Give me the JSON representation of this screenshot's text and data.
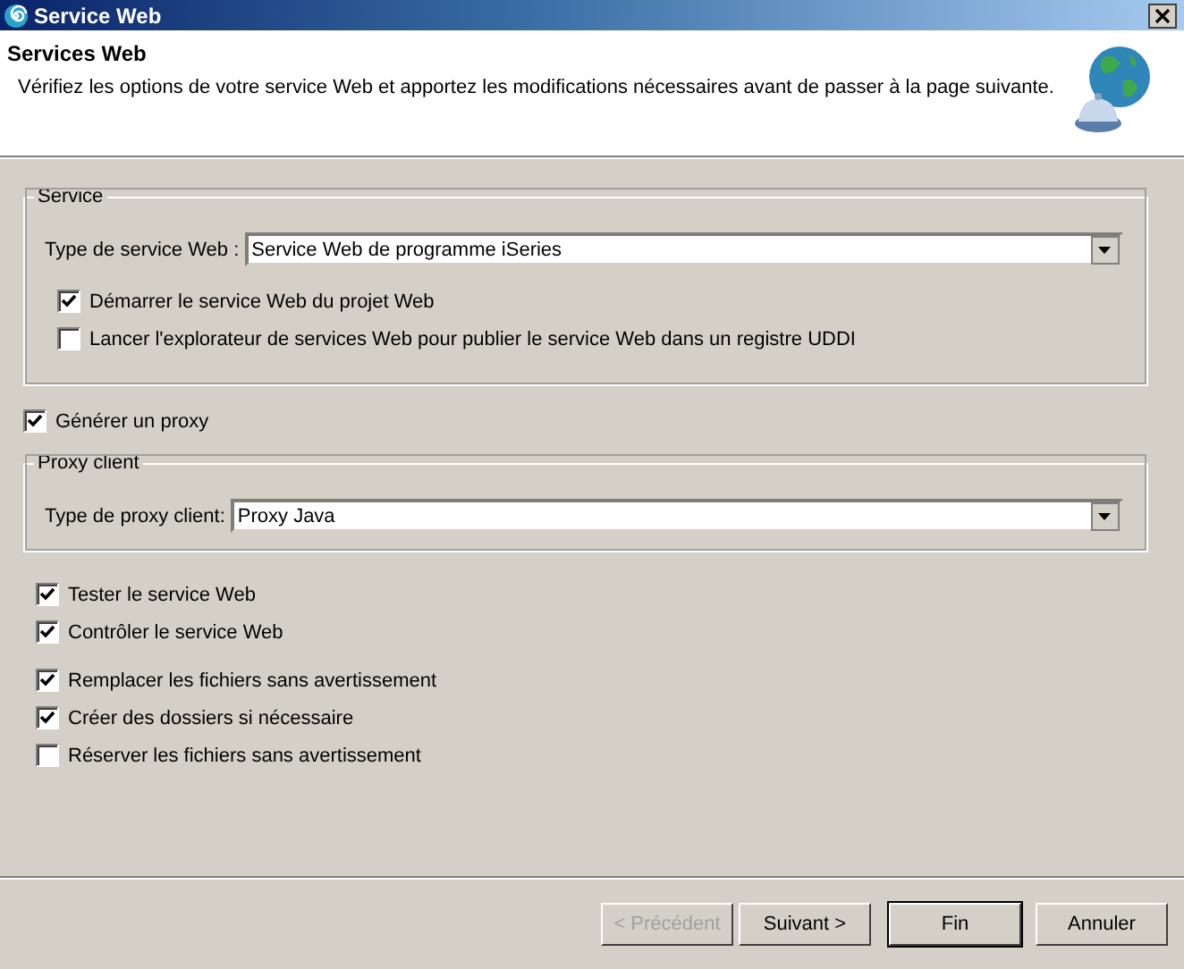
{
  "window": {
    "title": "Service Web"
  },
  "header": {
    "title": "Services Web",
    "description": "Vérifiez les options de votre service Web et apportez les modifications nécessaires avant de passer à la page suivante."
  },
  "service_group": {
    "legend": "Service",
    "type_label": "Type de service Web :",
    "type_value": "Service Web de programme iSeries",
    "options": [
      {
        "label": "Démarrer le service Web du projet Web",
        "checked": true
      },
      {
        "label": "Lancer l'explorateur de services Web pour publier le service Web dans un registre UDDI",
        "checked": false
      }
    ]
  },
  "generate_proxy": {
    "label": "Générer un proxy",
    "checked": true
  },
  "proxy_group": {
    "legend": "Proxy client",
    "type_label": "Type de proxy client:",
    "type_value": "Proxy Java"
  },
  "option_sets": [
    [
      {
        "label": "Tester le service Web",
        "checked": true
      },
      {
        "label": "Contrôler le service Web",
        "checked": true
      }
    ],
    [
      {
        "label": "Remplacer les fichiers sans avertissement",
        "checked": true
      },
      {
        "label": "Créer des dossiers si nécessaire",
        "checked": true
      },
      {
        "label": "Réserver les fichiers sans avertissement",
        "checked": false
      }
    ]
  ],
  "buttons": [
    {
      "label": "< Précédent",
      "disabled": true,
      "default": false
    },
    {
      "label": "Suivant >",
      "disabled": false,
      "default": false
    },
    {
      "label": "Fin",
      "disabled": false,
      "default": true
    },
    {
      "label": "Annuler",
      "disabled": false,
      "default": false
    }
  ]
}
